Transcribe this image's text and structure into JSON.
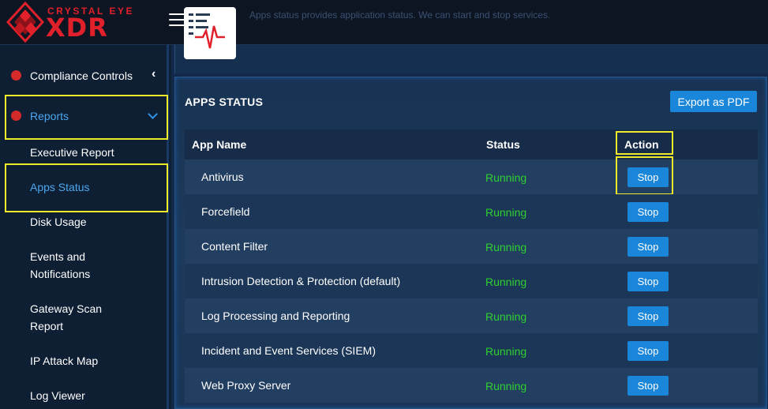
{
  "brand": {
    "tagline": "CRYSTAL EYE",
    "name": "XDR",
    "color": "#e0202a"
  },
  "header": {
    "description": "Apps status provides application status. We can start and stop services."
  },
  "sidebar": {
    "items": [
      {
        "label": "Compliance Controls",
        "icon": "dot-icon",
        "state": "collapsed"
      },
      {
        "label": "Reports",
        "icon": "dot-icon",
        "state": "expanded"
      }
    ],
    "subitems": [
      {
        "label": "Executive Report"
      },
      {
        "label": "Apps Status",
        "active": true
      },
      {
        "label": "Disk Usage"
      },
      {
        "label": "Events and Notifications",
        "line1": "Events and",
        "line2": "Notifications"
      },
      {
        "label": "Gateway Scan Report",
        "line1": "Gateway Scan",
        "line2": "Report"
      },
      {
        "label": "IP Attack Map"
      },
      {
        "label": "Log Viewer"
      }
    ]
  },
  "panel": {
    "title": "APPS STATUS",
    "export_label": "Export as PDF",
    "columns": [
      "App Name",
      "Status",
      "Action"
    ],
    "rows": [
      {
        "name": "Antivirus",
        "status": "Running",
        "action": "Stop"
      },
      {
        "name": "Forcefield",
        "status": "Running",
        "action": "Stop"
      },
      {
        "name": "Content Filter",
        "status": "Running",
        "action": "Stop"
      },
      {
        "name": "Intrusion Detection & Protection (default)",
        "status": "Running",
        "action": "Stop"
      },
      {
        "name": "Log Processing and Reporting",
        "status": "Running",
        "action": "Stop"
      },
      {
        "name": "Incident and Event Services (SIEM)",
        "status": "Running",
        "action": "Stop"
      },
      {
        "name": "Web Proxy Server",
        "status": "Running",
        "action": "Stop"
      }
    ]
  },
  "colors": {
    "accent": "#1a86d9",
    "running": "#2fd12f",
    "highlight": "#f0e92a",
    "active_link": "#4ba8f0"
  }
}
